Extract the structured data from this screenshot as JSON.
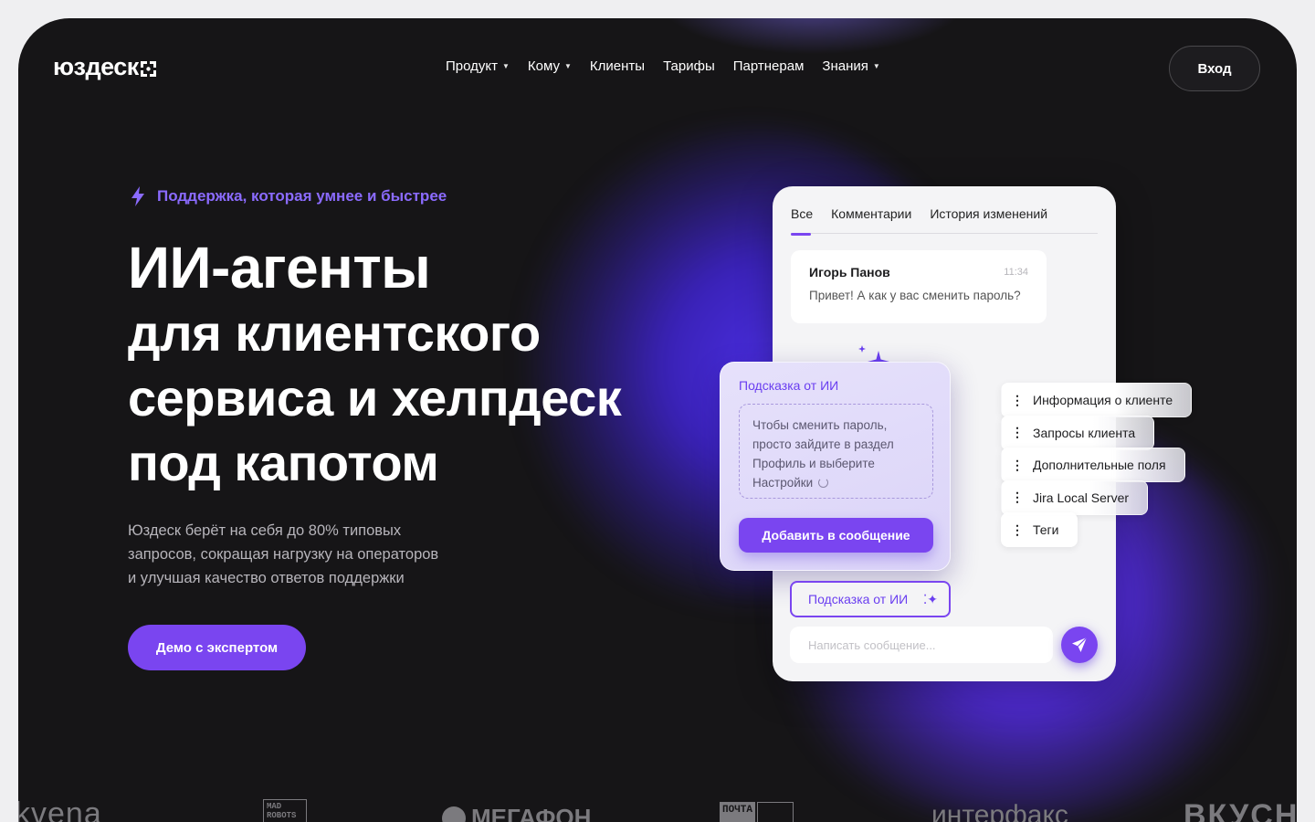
{
  "header": {
    "brand": "юздеск",
    "nav": [
      {
        "label": "Продукт",
        "has_caret": true
      },
      {
        "label": "Кому",
        "has_caret": true
      },
      {
        "label": "Клиенты",
        "has_caret": false
      },
      {
        "label": "Тарифы",
        "has_caret": false
      },
      {
        "label": "Партнерам",
        "has_caret": false
      },
      {
        "label": "Знания",
        "has_caret": true
      }
    ],
    "login_label": "Вход"
  },
  "hero": {
    "tagline": "Поддержка, которая умнее и быстрее",
    "headline": [
      "ИИ-агенты",
      "для клиентского",
      "сервиса и хелпдеск",
      "под капотом"
    ],
    "subtext": [
      "Юздеск берёт на себя до 80% типовых",
      "запросов, сокращая нагрузку на операторов",
      "и улучшая качество ответов поддержки"
    ],
    "cta_label": "Демо с экспертом"
  },
  "chat_card": {
    "tabs": [
      "Все",
      "Комментарии",
      "История изменений"
    ],
    "active_tab": "Все",
    "message": {
      "author": "Игорь Панов",
      "time": "11:34",
      "text": "Привет! А как у вас сменить пароль?"
    },
    "ai_panel": {
      "title": "Подсказка от ИИ",
      "suggestion": [
        "Чтобы сменить пароль,",
        "просто зайдите в раздел",
        "Профиль и выберите",
        "Настройки"
      ],
      "add_button": "Добавить в сообщение"
    },
    "side_items": [
      "Информация о клиенте",
      "Запросы клиента",
      "Дополнительные поля",
      "Jira Local Server",
      "Теги"
    ],
    "ai_hint_button": "Подсказка от ИИ",
    "compose_placeholder": "Написать сообщение..."
  },
  "client_logos": [
    "kvena",
    "MAD ROBOTS",
    "МЕГАФОН",
    "ПОЧТА",
    "интерфакс",
    "ВКУСНО"
  ],
  "colors": {
    "accent": "#7a45f0",
    "background": "#161517",
    "page": "#efeff1"
  }
}
